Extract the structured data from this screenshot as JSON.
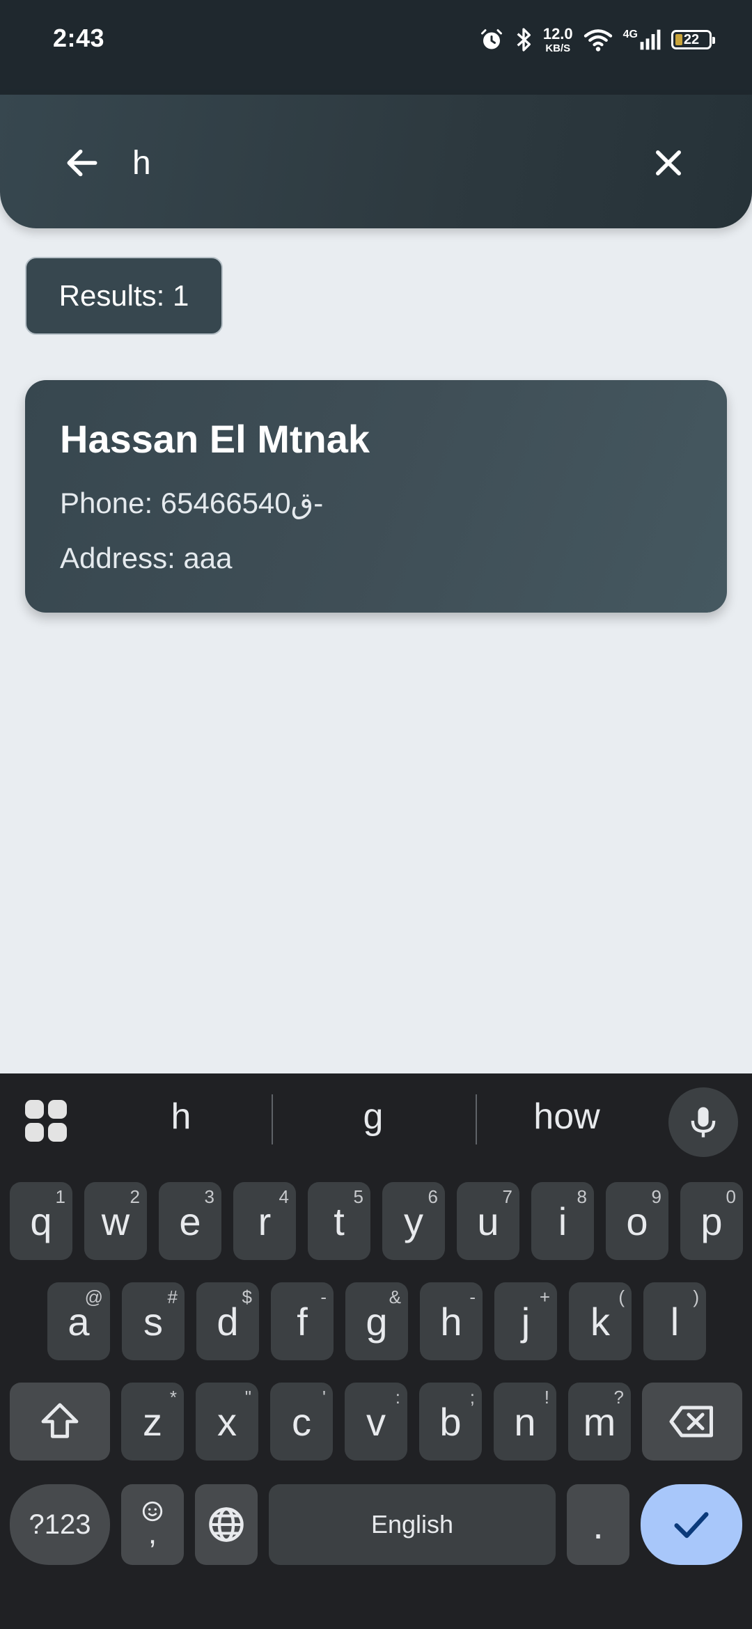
{
  "status_bar": {
    "time": "2:43",
    "speed_value": "12.0",
    "speed_unit": "KB/S",
    "network": "4G",
    "battery": "22",
    "icons": [
      "alarm-icon",
      "bluetooth-icon",
      "wifi-icon",
      "signal-icon",
      "battery-icon"
    ]
  },
  "search": {
    "query": "h",
    "back_icon": "arrow-left-icon",
    "clear_icon": "close-icon"
  },
  "results": {
    "label": "Results: 1"
  },
  "contacts": [
    {
      "name": "Hassan El Mtnak",
      "phone": "Phone: 65466540ق-",
      "address": "Address: aaa"
    }
  ],
  "keyboard": {
    "suggestions": [
      "h",
      "g",
      "how"
    ],
    "row1": [
      {
        "key": "q",
        "hint": "1"
      },
      {
        "key": "w",
        "hint": "2"
      },
      {
        "key": "e",
        "hint": "3"
      },
      {
        "key": "r",
        "hint": "4"
      },
      {
        "key": "t",
        "hint": "5"
      },
      {
        "key": "y",
        "hint": "6"
      },
      {
        "key": "u",
        "hint": "7"
      },
      {
        "key": "i",
        "hint": "8"
      },
      {
        "key": "o",
        "hint": "9"
      },
      {
        "key": "p",
        "hint": "0"
      }
    ],
    "row2": [
      {
        "key": "a",
        "hint": "@"
      },
      {
        "key": "s",
        "hint": "#"
      },
      {
        "key": "d",
        "hint": "$"
      },
      {
        "key": "f",
        "hint": "-"
      },
      {
        "key": "g",
        "hint": "&"
      },
      {
        "key": "h",
        "hint": "-"
      },
      {
        "key": "j",
        "hint": "+"
      },
      {
        "key": "k",
        "hint": "("
      },
      {
        "key": "l",
        "hint": ")"
      }
    ],
    "row3": [
      {
        "key": "z",
        "hint": "*"
      },
      {
        "key": "x",
        "hint": "\""
      },
      {
        "key": "c",
        "hint": "'"
      },
      {
        "key": "v",
        "hint": ":"
      },
      {
        "key": "b",
        "hint": ";"
      },
      {
        "key": "n",
        "hint": "!"
      },
      {
        "key": "m",
        "hint": "?"
      }
    ],
    "symbols_label": "?123",
    "comma_label": ",",
    "space_label": "English",
    "period_label": "."
  },
  "colors": {
    "header": "#37474f",
    "card": "#3f4e56",
    "background": "#e9edf1",
    "keyboard": "#202124",
    "enter_key": "#a8c7fa"
  }
}
